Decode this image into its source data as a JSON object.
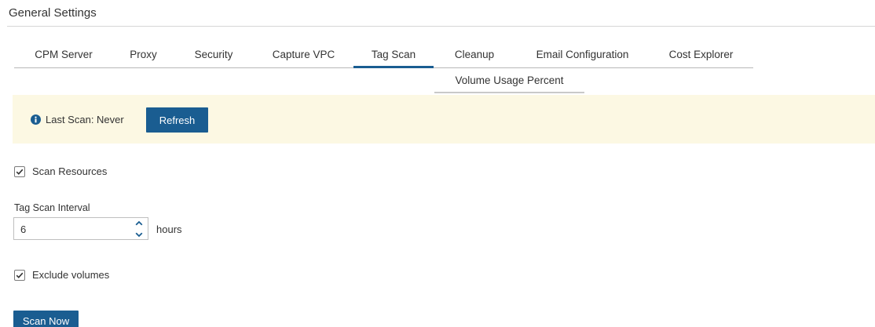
{
  "page": {
    "title": "General Settings"
  },
  "tabs": [
    {
      "label": "CPM Server",
      "active": false
    },
    {
      "label": "Proxy",
      "active": false
    },
    {
      "label": "Security",
      "active": false
    },
    {
      "label": "Capture VPC",
      "active": false
    },
    {
      "label": "Tag Scan",
      "active": true
    },
    {
      "label": "Cleanup",
      "active": false
    },
    {
      "label": "Email Configuration",
      "active": false
    },
    {
      "label": "Cost Explorer",
      "active": false
    }
  ],
  "subtabs": [
    {
      "label": "Volume Usage Percent"
    }
  ],
  "banner": {
    "icon": "info-icon",
    "last_scan_text": "Last Scan: Never",
    "refresh_label": "Refresh",
    "background": "#fcf8e3"
  },
  "form": {
    "scan_resources": {
      "label": "Scan Resources",
      "checked": true
    },
    "tag_scan_interval": {
      "label": "Tag Scan Interval",
      "value": "6",
      "unit": "hours"
    },
    "exclude_volumes": {
      "label": "Exclude volumes",
      "checked": true
    },
    "scan_now_label": "Scan Now"
  },
  "colors": {
    "accent": "#1a5d91",
    "text": "#333333",
    "border": "#b8b8b8"
  }
}
